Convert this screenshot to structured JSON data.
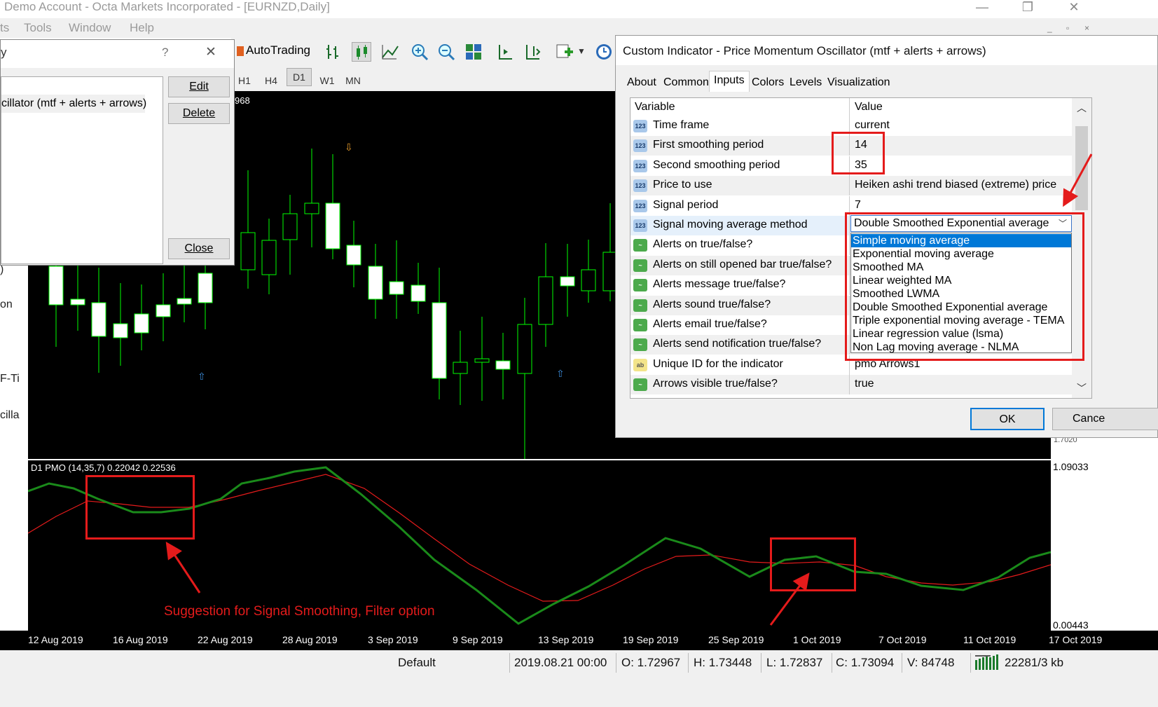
{
  "window": {
    "title": "Demo Account - Octa Markets Incorporated - [EURNZD,Daily]",
    "controls": [
      "—",
      "❐",
      "✕"
    ]
  },
  "menu": {
    "items": [
      "ts",
      "Tools",
      "Window",
      "Help"
    ],
    "mdi_controls": [
      "_",
      "▫",
      "×"
    ]
  },
  "toolbar": {
    "autotrading": "AutoTrading",
    "timeframes": [
      "H1",
      "H4",
      "D1",
      "W1",
      "MN"
    ],
    "selected": "D1"
  },
  "left_fragments": {
    "frag1": ")",
    "frag2": "on",
    "frag3": "F-Ti",
    "frag4": "cilla"
  },
  "indicators_dialog": {
    "title_fragment": "y",
    "help": "?",
    "close_x": "✕",
    "list_item": "cillator (mtf + alerts + arrows)",
    "edit": "Edit",
    "delete": "Delete",
    "close": "Close"
  },
  "chart": {
    "price_fragment": "968",
    "indicator_label": "D1 PMO (14,35,7) 0.22042 0.22536",
    "scale_top": "1.09033",
    "scale_bottom": "0.00443",
    "scale_fragment": "1.7020",
    "dates": [
      "12 Aug 2019",
      "16 Aug 2019",
      "22 Aug 2019",
      "28 Aug 2019",
      "3 Sep 2019",
      "9 Sep 2019",
      "13 Sep 2019",
      "19 Sep 2019",
      "25 Sep 2019",
      "1 Oct 2019",
      "7 Oct 2019",
      "11 Oct 2019",
      "17 Oct 2019"
    ],
    "colors": {
      "bull": "#00ff00",
      "candle_body": "#ffffff",
      "pmo_line": "#1a8a1a",
      "signal_line": "#e41b1b"
    }
  },
  "annotation": "Suggestion for Signal Smoothing, Filter option",
  "custom_dialog": {
    "title": "Custom Indicator - Price Momentum Oscillator (mtf + alerts + arrows)",
    "tabs": [
      "About",
      "Common",
      "Inputs",
      "Colors",
      "Levels",
      "Visualization"
    ],
    "active_tab": "Inputs",
    "headers": {
      "variable": "Variable",
      "value": "Value"
    },
    "rows": [
      {
        "icon": "123",
        "name": "Time frame",
        "value": "current"
      },
      {
        "icon": "123",
        "name": "First smoothing period",
        "value": "14"
      },
      {
        "icon": "123",
        "name": "Second smoothing period",
        "value": "35"
      },
      {
        "icon": "123",
        "name": "Price to use",
        "value": "Heiken ashi trend biased (extreme) price"
      },
      {
        "icon": "123",
        "name": "Signal period",
        "value": "7"
      },
      {
        "icon": "123",
        "name": "Signal moving average method",
        "value": ""
      },
      {
        "icon": "bool",
        "name": "Alerts on true/false?",
        "value": ""
      },
      {
        "icon": "bool",
        "name": "Alerts on still opened bar true/false?",
        "value": ""
      },
      {
        "icon": "bool",
        "name": "Alerts message true/false?",
        "value": ""
      },
      {
        "icon": "bool",
        "name": "Alerts sound true/false?",
        "value": ""
      },
      {
        "icon": "bool",
        "name": "Alerts email true/false?",
        "value": ""
      },
      {
        "icon": "bool",
        "name": "Alerts send notification true/false?",
        "value": ""
      },
      {
        "icon": "ab",
        "name": "Unique ID for the indicator",
        "value": "pmo Arrows1"
      },
      {
        "icon": "bool",
        "name": "Arrows visible true/false?",
        "value": "true"
      }
    ],
    "dropdown_value": "Double Smoothed Exponential average",
    "dropdown_options": [
      "Simple moving average",
      "Exponential moving average",
      "Smoothed MA",
      "Linear weighted MA",
      "Smoothed LWMA",
      "Double Smoothed Exponential average",
      "Triple exponential moving average - TEMA",
      "Linear regression value (lsma)",
      "Non Lag moving average - NLMA"
    ],
    "highlighted_option": "Simple moving average",
    "ok": "OK",
    "cancel": "Cance"
  },
  "status": {
    "profile": "Default",
    "datetime": "2019.08.21 00:00",
    "open": "O: 1.72967",
    "high": "H: 1.73448",
    "low": "L: 1.72837",
    "close": "C: 1.73094",
    "volume": "V: 84748",
    "traffic": "22281/3 kb"
  }
}
